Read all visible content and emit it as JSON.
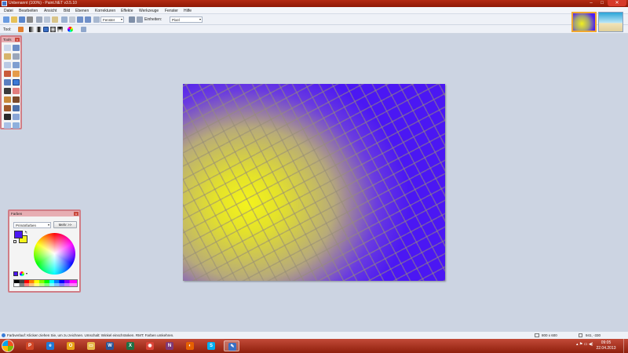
{
  "window": {
    "title": "Unbenannt (100%) - Paint.NET v3.5.10",
    "min": "–",
    "max": "□",
    "close": "✕"
  },
  "menu": [
    "Datei",
    "Bearbeiten",
    "Ansicht",
    "Bild",
    "Ebenen",
    "Korrekturen",
    "Effekte",
    "Werkzeuge",
    "Fenster",
    "Hilfe"
  ],
  "toolbar": {
    "zoom_value": "Fenster",
    "units_label": "Einheiten:",
    "units_value": "Pixel",
    "tool_label": "Tool:"
  },
  "tools_window": {
    "title": "Tools",
    "close": "x"
  },
  "colors_window": {
    "title": "Farben",
    "close": "x",
    "palette_select": "Primärfarben",
    "more_button": "Mehr >>",
    "primary_color": "#4b17f3",
    "secondary_color": "#f4f31d"
  },
  "status": {
    "text": "Farbverlauf: Klicken ziehen Sie, um zu zeichnen. Umschalt: Winkel einschränken. RMT: Farben umkehren.",
    "size": "800 x 600",
    "coords": "941, -330"
  },
  "taskbar": {
    "clock_time": "09:05",
    "clock_date": "22.04.2013",
    "apps": [
      {
        "name": "powerpoint",
        "letter": "P",
        "color": "#d24726"
      },
      {
        "name": "internet-explorer",
        "letter": "e",
        "color": "#1f7bd6"
      },
      {
        "name": "outlook",
        "letter": "O",
        "color": "#e8a317"
      },
      {
        "name": "explorer",
        "letter": "▭",
        "color": "#e7b94a"
      },
      {
        "name": "word",
        "letter": "W",
        "color": "#2b5797"
      },
      {
        "name": "excel",
        "letter": "X",
        "color": "#1e7145"
      },
      {
        "name": "chrome",
        "letter": "◉",
        "color": "#db4437"
      },
      {
        "name": "onenote",
        "letter": "N",
        "color": "#7e3878"
      },
      {
        "name": "firefox",
        "letter": "◐",
        "color": "#e66000"
      },
      {
        "name": "skype",
        "letter": "S",
        "color": "#00aff0"
      },
      {
        "name": "paint-net",
        "letter": "✎",
        "color": "#3a6fc4"
      }
    ]
  }
}
